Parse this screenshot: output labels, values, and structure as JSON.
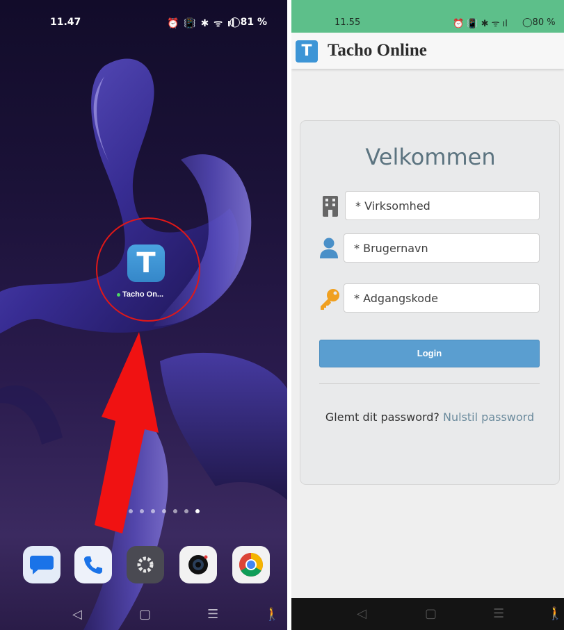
{
  "left_screen": {
    "status": {
      "time": "11.47",
      "icons": "⏰ 📳 ✱ ᯤ ıl",
      "battery": "◯81 %"
    },
    "home_app": {
      "icon_letter": "T",
      "label": "Tacho On..."
    },
    "page_dots_count": 7,
    "page_dots_active_index": 6,
    "dock": [
      {
        "name": "messages-icon"
      },
      {
        "name": "phone-icon"
      },
      {
        "name": "settings-icon"
      },
      {
        "name": "camera-icon"
      },
      {
        "name": "chrome-icon"
      }
    ],
    "nav": {
      "back": "◁",
      "home": "▢",
      "recents": "☰",
      "accessibility": "🚶"
    }
  },
  "right_screen": {
    "status": {
      "time": "11.55",
      "icons": "⏰ 📳 ✱ ᯤ ıl",
      "battery": "◯80 %"
    },
    "header": {
      "logo_letter": "T",
      "title": "Tacho Online"
    },
    "login": {
      "welcome": "Velkommen",
      "company_placeholder": "* Virksomhed",
      "username_placeholder": "* Brugernavn",
      "password_placeholder": "* Adgangskode",
      "login_label": "Login",
      "forgot_text": "Glemt dit password?",
      "reset_link": "Nulstil password"
    },
    "nav": {
      "back": "◁",
      "home": "▢",
      "recents": "☰",
      "accessibility": "🚶"
    }
  },
  "colors": {
    "status_bar_green": "#5dbf8a",
    "accent_blue": "#3d95d6",
    "login_button": "#5a9ed0",
    "highlight_red": "#e01818"
  }
}
